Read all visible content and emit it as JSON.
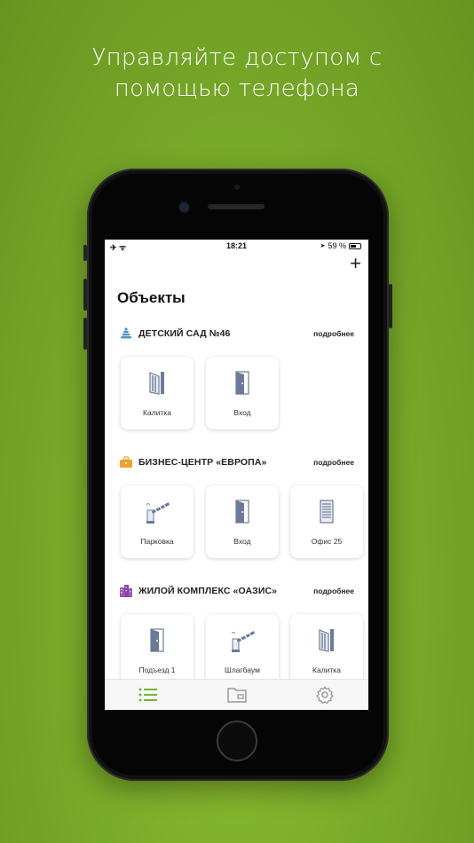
{
  "headline": {
    "line1": "Управляйте доступом с",
    "line2": "помощью телефона"
  },
  "status_bar": {
    "left_icons": "✈ ᯤ",
    "time": "18:21",
    "location_icon": "➤",
    "battery_percent": "59 %"
  },
  "header": {
    "add_label": "+",
    "title": "Объекты"
  },
  "sections": [
    {
      "name": "ДЕТСКИЙ САД №46",
      "more": "подробнее",
      "icon": "pyramid-toy-icon",
      "icon_color": "#4a90c8",
      "tiles": [
        {
          "label": "Калитка",
          "icon": "gate-icon"
        },
        {
          "label": "Вход",
          "icon": "door-icon"
        }
      ]
    },
    {
      "name": "БИЗНЕС-ЦЕНТР «ЕВРОПА»",
      "more": "подробнее",
      "icon": "briefcase-icon",
      "icon_color": "#f0a030",
      "tiles": [
        {
          "label": "Парковка",
          "icon": "barrier-icon"
        },
        {
          "label": "Вход",
          "icon": "door-icon"
        },
        {
          "label": "Офис 25",
          "icon": "shutter-icon"
        }
      ]
    },
    {
      "name": "ЖИЛОЙ КОМПЛЕКС «ОАЗИС»",
      "more": "подробнее",
      "icon": "building-icon",
      "icon_color": "#9b59b6",
      "tiles": [
        {
          "label": "Подъезд 1",
          "icon": "door-icon"
        },
        {
          "label": "Шлагбаум",
          "icon": "barrier-icon"
        },
        {
          "label": "Калитка",
          "icon": "gate-icon"
        }
      ]
    }
  ],
  "tabbar": {
    "items": [
      "list-icon",
      "folder-card-icon",
      "gear-icon"
    ],
    "active_color": "#7ab32e",
    "inactive_color": "#9a9a9a"
  },
  "colors": {
    "background": "#7aac2a",
    "icon_slate": "#6b7a99"
  }
}
